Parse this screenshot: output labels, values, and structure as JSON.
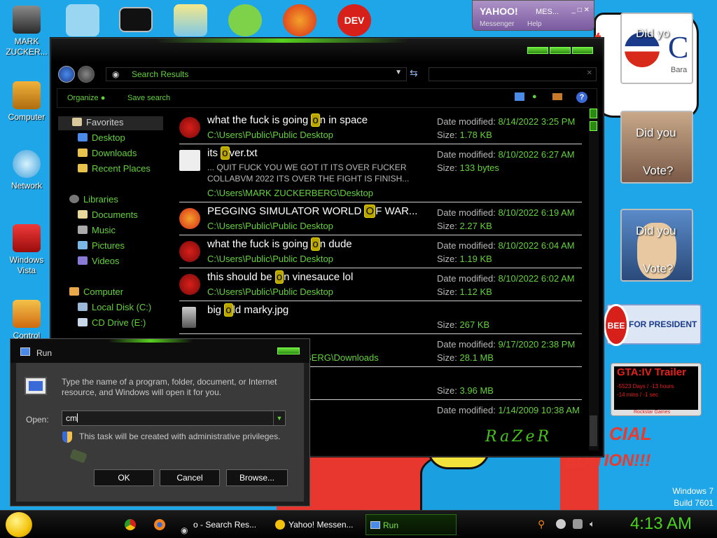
{
  "desktop": {
    "icons": [
      {
        "label": "MARK ZUCKER..."
      },
      {
        "label": "Computer"
      },
      {
        "label": "Network"
      },
      {
        "label": "Windows Vista"
      },
      {
        "label": "Control"
      }
    ],
    "watermark": {
      "line1": "Windows 7",
      "line2": "Build 7601"
    }
  },
  "wallpaper": {
    "text_cial": "CIAL",
    "text_edition": "EDITION!!!",
    "bee": "BEE",
    "for_president": "FOR PRESIDENT"
  },
  "gadgets": {
    "obama": {
      "caption": "Did yo",
      "sub": "Bara"
    },
    "mccain": {
      "caption_top": "Did you",
      "caption_bottom": "Vote?"
    },
    "clinton": {
      "caption_top": "Did you",
      "caption_bottom": "Vote?"
    },
    "gta": {
      "title": "GTA:IV Trailer",
      "line1": "-5523 Days / -13 hours",
      "line2": "-14 mins / -1 sec",
      "footer": "Rockstar Games"
    }
  },
  "yahoo": {
    "logo": "YAHOO!",
    "title": "MES...",
    "menu1": "Messenger",
    "menu2": "Help"
  },
  "explorer": {
    "address": "Search Results",
    "toolbar": {
      "organize": "Organize",
      "save_search": "Save search"
    },
    "nav": {
      "favorites": "Favorites",
      "desktop": "Desktop",
      "downloads": "Downloads",
      "recent": "Recent Places",
      "libraries": "Libraries",
      "documents": "Documents",
      "music": "Music",
      "pictures": "Pictures",
      "videos": "Videos",
      "computer": "Computer",
      "local_disk": "Local Disk (C:)",
      "cd_drive": "CD Drive (E:)"
    },
    "labels": {
      "date_modified": "Date modified:",
      "size": "Size:"
    },
    "results": [
      {
        "name_a": "what the fuck is going ",
        "hl": "o",
        "name_b": "n in space",
        "path": "C:\\Users\\Public\\Public Desktop",
        "date": "8/14/2022 3:25 PM",
        "size": "1.78 KB"
      },
      {
        "name_a": "its ",
        "hl": "o",
        "name_b": "ver.txt",
        "snip1": "... QUIT FUCK YOU WE GOT IT ITS OVER FUCKER",
        "snip2": "COLLABVM 2022 ITS OVER THE FIGHT IS FINISH...",
        "path": "C:\\Users\\MARK ZUCKERBERG\\Desktop",
        "date": "8/10/2022 6:27 AM",
        "size": "133 bytes"
      },
      {
        "name_a": "PEGGING SIMULATOR WORLD ",
        "hl": "O",
        "name_b": "F WAR...",
        "path": "C:\\Users\\Public\\Public Desktop",
        "date": "8/10/2022 6:19 AM",
        "size": "2.27 KB"
      },
      {
        "name_a": "what the fuck is going ",
        "hl": "o",
        "name_b": "n dude",
        "path": "C:\\Users\\Public\\Public Desktop",
        "date": "8/10/2022 6:04 AM",
        "size": "1.19 KB"
      },
      {
        "name_a": "this should be ",
        "hl": "o",
        "name_b": "n vinesauce lol",
        "path": "C:\\Users\\Public\\Public Desktop",
        "date": "8/10/2022 6:02 AM",
        "size": "1.12 KB"
      },
      {
        "name_a": "big ",
        "hl": "o",
        "name_b": "ld marky.jpg",
        "path": "",
        "date": "",
        "size": "267 KB"
      },
      {
        "name_a": "",
        "hl": "",
        "name_b": "",
        "path": "BERG\\Downloads",
        "date": "9/17/2020 2:38 PM",
        "size": "28.1 MB"
      },
      {
        "name_a": "",
        "hl": "",
        "name_b": "",
        "path": "",
        "date": "",
        "size": "3.96 MB"
      },
      {
        "name_a": "",
        "hl": "",
        "name_b": "",
        "path": "",
        "date": "1/14/2009 10:38 AM",
        "size": ""
      }
    ],
    "logo": "RaZeR"
  },
  "run": {
    "title": "Run",
    "description": "Type the name of a program, folder, document, or Internet resource, and Windows will open it for you.",
    "open_label": "Open:",
    "input_value": "cm",
    "admin_note": "This task will be created with administrative privileges.",
    "ok": "OK",
    "cancel": "Cancel",
    "browse": "Browse..."
  },
  "taskbar": {
    "items": [
      {
        "label": "o - Search Res..."
      },
      {
        "label": "Yahoo! Messen..."
      },
      {
        "label": "Run"
      }
    ],
    "clock": "4:13 AM"
  },
  "colors": {
    "accent": "#4bd11e",
    "desktop": "#1ea6e8",
    "highlight": "#b8a400"
  }
}
